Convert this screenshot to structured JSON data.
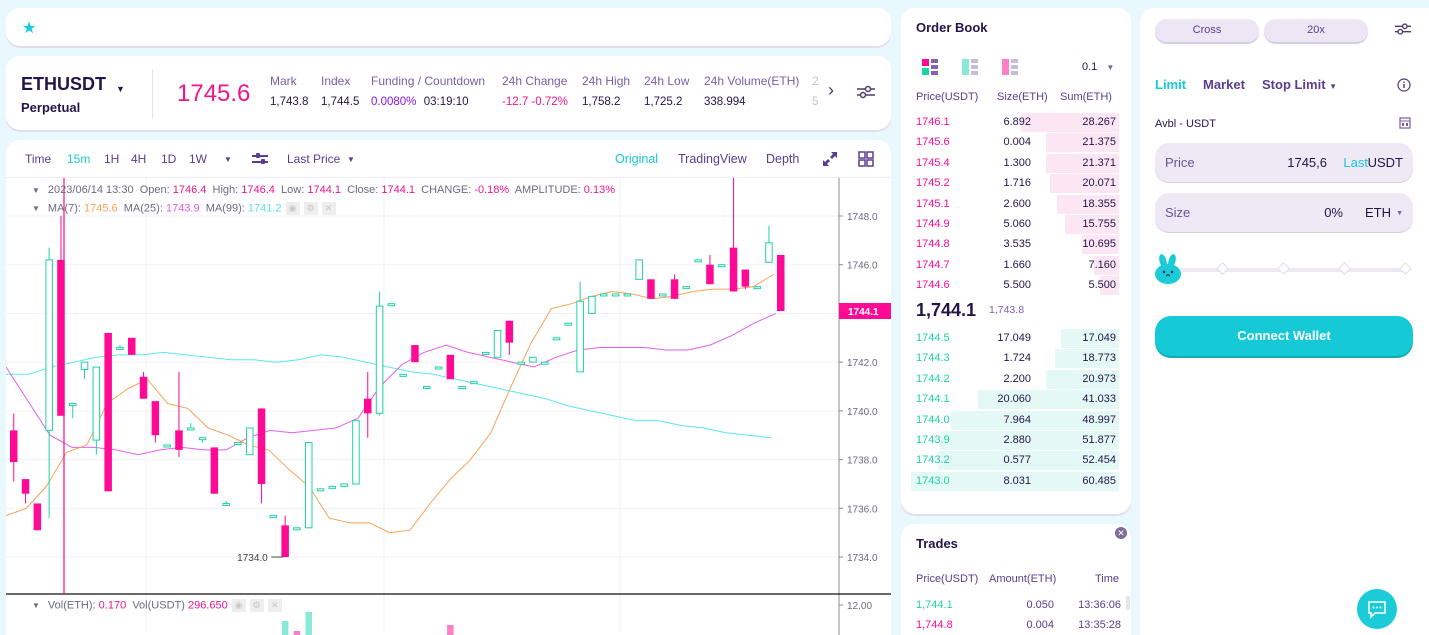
{
  "favorites": {
    "star_icon": "star-icon"
  },
  "ticker": {
    "symbol": "ETHUSDT",
    "type": "Perpetual",
    "last_price": "1745.6",
    "stats": [
      {
        "label": "Mark",
        "value": "1,743.8",
        "style": ""
      },
      {
        "label": "Index",
        "value": "1,744.5",
        "style": ""
      },
      {
        "label": "Funding / Countdown",
        "value": "0.0080%",
        "value2": "03:19:10",
        "style": "p"
      },
      {
        "label": "24h Change",
        "value": "-12.7 -0.72%",
        "style": "r"
      },
      {
        "label": "24h High",
        "value": "1,758.2",
        "style": ""
      },
      {
        "label": "24h Low",
        "value": "1,725.2",
        "style": ""
      },
      {
        "label": "24h Volume(ETH)",
        "value": "338.994",
        "style": ""
      },
      {
        "label": "2",
        "value": "5",
        "style": "faded"
      }
    ]
  },
  "chart_toolbar": {
    "intervals": [
      "Time",
      "15m",
      "1H",
      "4H",
      "1D",
      "1W"
    ],
    "active_interval": "15m",
    "price_type": "Last Price",
    "views": [
      "Original",
      "TradingView",
      "Depth"
    ],
    "active_view": "Original"
  },
  "chart_legend": {
    "date": "2023/06/14 13:30",
    "open_label": "Open:",
    "open": "1746.4",
    "high_label": "High:",
    "high": "1746.4",
    "low_label": "Low:",
    "low": "1744.1",
    "close_label": "Close:",
    "close": "1744.1",
    "change_label": "CHANGE:",
    "change": "-0.18%",
    "amp_label": "AMPLITUDE:",
    "amplitude": "0.13%",
    "ma7_label": "MA(7):",
    "ma7": "1745.6",
    "ma25_label": "MA(25):",
    "ma25": "1743.9",
    "ma99_label": "MA(99):",
    "ma99": "1741.2",
    "vol_eth_label": "Vol(ETH):",
    "vol_eth": "0.170",
    "vol_usdt_label": "Vol(USDT)",
    "vol_usdt": "296.650"
  },
  "chart_data": {
    "type": "candlestick",
    "title": "ETHUSDT 15m",
    "ylim": [
      1732.4,
      1749.4
    ],
    "yticks": [
      1748.0,
      1746.0,
      1744.0,
      1742.0,
      1740.0,
      1738.0,
      1736.0,
      1734.0
    ],
    "ytick_labels": [
      "1748.0",
      "1746.0",
      "",
      "1742.0",
      "1740.0",
      "1738.0",
      "1736.0",
      "1734.0"
    ],
    "current_price_label": "1744.1",
    "min_marker_label": "1734.0",
    "vol_ytick_label": "12.00",
    "candles": [
      {
        "o": 1739.2,
        "h": 1739.9,
        "l": 1737.1,
        "c": 1737.9
      },
      {
        "o": 1737.2,
        "h": 1737.2,
        "l": 1736.2,
        "c": 1736.6
      },
      {
        "o": 1736.2,
        "h": 1736.2,
        "l": 1735.1,
        "c": 1735.1
      },
      {
        "o": 1739.2,
        "h": 1746.7,
        "l": 1735.6,
        "c": 1746.2
      },
      {
        "o": 1746.2,
        "h": 1748.0,
        "l": 1739.8,
        "c": 1739.8
      },
      {
        "o": 1740.3,
        "h": 1740.3,
        "l": 1739.7,
        "c": 1740.3
      },
      {
        "o": 1741.7,
        "h": 1742.0,
        "l": 1741.3,
        "c": 1742.0
      },
      {
        "o": 1738.8,
        "h": 1741.8,
        "l": 1738.2,
        "c": 1741.8
      },
      {
        "o": 1743.2,
        "h": 1743.2,
        "l": 1736.7,
        "c": 1736.7
      },
      {
        "o": 1742.6,
        "h": 1742.7,
        "l": 1742.6,
        "c": 1742.6
      },
      {
        "o": 1743.0,
        "h": 1743.0,
        "l": 1742.3,
        "c": 1742.3
      },
      {
        "o": 1741.4,
        "h": 1741.6,
        "l": 1740.5,
        "c": 1740.5
      },
      {
        "o": 1740.4,
        "h": 1740.4,
        "l": 1738.7,
        "c": 1739.0
      },
      {
        "o": 1738.6,
        "h": 1738.6,
        "l": 1738.6,
        "c": 1738.6
      },
      {
        "o": 1739.2,
        "h": 1741.6,
        "l": 1738.1,
        "c": 1738.4
      },
      {
        "o": 1739.3,
        "h": 1739.5,
        "l": 1739.3,
        "c": 1739.3
      },
      {
        "o": 1738.9,
        "h": 1738.9,
        "l": 1738.7,
        "c": 1738.9
      },
      {
        "o": 1738.5,
        "h": 1738.5,
        "l": 1736.6,
        "c": 1736.6
      },
      {
        "o": 1736.2,
        "h": 1736.3,
        "l": 1736.2,
        "c": 1736.2
      },
      {
        "o": 1738.7,
        "h": 1738.7,
        "l": 1738.7,
        "c": 1738.7
      },
      {
        "o": 1738.2,
        "h": 1739.3,
        "l": 1738.2,
        "c": 1739.3
      },
      {
        "o": 1740.1,
        "h": 1740.1,
        "l": 1736.2,
        "c": 1737.0
      },
      {
        "o": 1735.7,
        "h": 1735.7,
        "l": 1735.7,
        "c": 1735.7
      },
      {
        "o": 1735.3,
        "h": 1735.7,
        "l": 1734.0,
        "c": 1734.0
      },
      {
        "o": 1735.2,
        "h": 1735.2,
        "l": 1735.2,
        "c": 1735.2
      },
      {
        "o": 1735.2,
        "h": 1738.7,
        "l": 1735.2,
        "c": 1738.7
      },
      {
        "o": 1736.8,
        "h": 1736.8,
        "l": 1736.8,
        "c": 1736.8
      },
      {
        "o": 1736.9,
        "h": 1736.9,
        "l": 1736.9,
        "c": 1736.9
      },
      {
        "o": 1736.9,
        "h": 1737.0,
        "l": 1736.9,
        "c": 1737.0
      },
      {
        "o": 1737.0,
        "h": 1739.6,
        "l": 1737.0,
        "c": 1739.6
      },
      {
        "o": 1740.5,
        "h": 1741.6,
        "l": 1738.9,
        "c": 1739.9
      },
      {
        "o": 1739.9,
        "h": 1744.9,
        "l": 1739.8,
        "c": 1744.3
      },
      {
        "o": 1744.4,
        "h": 1744.4,
        "l": 1744.4,
        "c": 1744.4
      },
      {
        "o": 1741.5,
        "h": 1741.5,
        "l": 1741.5,
        "c": 1741.5
      },
      {
        "o": 1742.7,
        "h": 1742.7,
        "l": 1742.0,
        "c": 1742.0
      },
      {
        "o": 1741.0,
        "h": 1741.0,
        "l": 1741.0,
        "c": 1741.0
      },
      {
        "o": 1741.8,
        "h": 1741.8,
        "l": 1741.8,
        "c": 1741.8
      },
      {
        "o": 1742.3,
        "h": 1742.3,
        "l": 1741.3,
        "c": 1741.3
      },
      {
        "o": 1741.0,
        "h": 1741.0,
        "l": 1741.0,
        "c": 1741.0
      },
      {
        "o": 1741.2,
        "h": 1741.2,
        "l": 1741.2,
        "c": 1741.2
      },
      {
        "o": 1742.4,
        "h": 1742.4,
        "l": 1742.4,
        "c": 1742.4
      },
      {
        "o": 1742.2,
        "h": 1743.3,
        "l": 1742.2,
        "c": 1743.3
      },
      {
        "o": 1743.7,
        "h": 1743.7,
        "l": 1742.3,
        "c": 1742.8
      },
      {
        "o": 1742.0,
        "h": 1742.0,
        "l": 1742.0,
        "c": 1742.0
      },
      {
        "o": 1742.0,
        "h": 1742.2,
        "l": 1742.0,
        "c": 1742.2
      },
      {
        "o": 1742.0,
        "h": 1742.0,
        "l": 1742.0,
        "c": 1742.0
      },
      {
        "o": 1743.0,
        "h": 1743.0,
        "l": 1743.0,
        "c": 1743.0
      },
      {
        "o": 1743.6,
        "h": 1743.6,
        "l": 1743.5,
        "c": 1743.6
      },
      {
        "o": 1741.6,
        "h": 1745.3,
        "l": 1741.6,
        "c": 1744.5
      },
      {
        "o": 1744.0,
        "h": 1744.7,
        "l": 1744.0,
        "c": 1744.7
      },
      {
        "o": 1744.8,
        "h": 1744.8,
        "l": 1744.8,
        "c": 1744.8
      },
      {
        "o": 1744.8,
        "h": 1744.8,
        "l": 1744.8,
        "c": 1744.8
      },
      {
        "o": 1744.8,
        "h": 1744.8,
        "l": 1744.8,
        "c": 1744.8
      },
      {
        "o": 1745.4,
        "h": 1746.2,
        "l": 1745.4,
        "c": 1746.2
      },
      {
        "o": 1745.4,
        "h": 1745.4,
        "l": 1744.6,
        "c": 1744.6
      },
      {
        "o": 1744.8,
        "h": 1744.8,
        "l": 1744.8,
        "c": 1744.8
      },
      {
        "o": 1745.4,
        "h": 1745.6,
        "l": 1744.6,
        "c": 1744.6
      },
      {
        "o": 1745.1,
        "h": 1745.1,
        "l": 1745.1,
        "c": 1745.1
      },
      {
        "o": 1746.2,
        "h": 1746.2,
        "l": 1746.2,
        "c": 1746.2
      },
      {
        "o": 1746.0,
        "h": 1746.4,
        "l": 1745.2,
        "c": 1745.2
      },
      {
        "o": 1746.0,
        "h": 1746.0,
        "l": 1746.0,
        "c": 1746.0
      },
      {
        "o": 1746.7,
        "h": 1750.0,
        "l": 1744.9,
        "c": 1744.9
      },
      {
        "o": 1745.8,
        "h": 1745.8,
        "l": 1745.0,
        "c": 1745.1
      },
      {
        "o": 1745.1,
        "h": 1745.1,
        "l": 1745.1,
        "c": 1745.1
      },
      {
        "o": 1746.1,
        "h": 1747.6,
        "l": 1746.1,
        "c": 1746.9
      },
      {
        "o": 1746.4,
        "h": 1746.4,
        "l": 1744.1,
        "c": 1744.1
      }
    ],
    "ma7": [
      1735.7,
      1736.0,
      1736.9,
      1738.3,
      1738.6,
      1740.3,
      1740.9,
      1741.3,
      1740.3,
      1740.1,
      1739.3,
      1739.0,
      1738.6,
      1738.4,
      1737.6,
      1736.9,
      1735.6,
      1735.4,
      1735.4,
      1735.0,
      1735.1,
      1736.2,
      1737.2,
      1738.0,
      1739.1,
      1741.0,
      1742.8,
      1744.2,
      1744.4,
      1744.7,
      1744.9,
      1744.8,
      1744.6,
      1744.7,
      1744.9,
      1745.0,
      1745.0,
      1745.1,
      1745.6
    ],
    "ma7_x_start": 0,
    "ma25": [
      1741.8,
      1740.4,
      1739.0,
      1738.5,
      1738.5,
      1738.4,
      1738.2,
      1738.4,
      1738.5,
      1738.4,
      1738.4,
      1738.9,
      1739.2,
      1739.1,
      1739.2,
      1739.3,
      1739.7,
      1741.0,
      1741.9,
      1742.4,
      1742.7,
      1742.4,
      1742.2,
      1742.0,
      1741.8,
      1742.2,
      1742.5,
      1742.6,
      1742.6,
      1742.6,
      1742.5,
      1742.5,
      1742.7,
      1743.1,
      1743.6,
      1744.0
    ],
    "ma99": [
      1741.5,
      1741.5,
      1741.8,
      1742.0,
      1742.2,
      1742.3,
      1742.3,
      1742.4,
      1742.3,
      1742.2,
      1742.1,
      1742.1,
      1742.0,
      1742.1,
      1742.3,
      1742.2,
      1742.0,
      1741.8,
      1741.6,
      1741.5,
      1741.3,
      1741.1,
      1740.9,
      1740.7,
      1740.5,
      1740.2,
      1740.0,
      1739.8,
      1739.6,
      1739.6,
      1739.4,
      1739.3,
      1739.1,
      1739.0,
      1738.9
    ],
    "volumes_visible": [
      {
        "index": 23,
        "v": 7.0,
        "dir": "up"
      },
      {
        "index": 24,
        "v": 2.0,
        "dir": "down"
      },
      {
        "index": 25,
        "v": 11.5,
        "dir": "up"
      },
      {
        "index": 37,
        "v": 5.0,
        "dir": "down"
      }
    ]
  },
  "orderbook": {
    "title": "Order Book",
    "precision": "0.1",
    "headers": [
      "Price(USDT)",
      "Size(ETH)",
      "Sum(ETH)"
    ],
    "asks": [
      {
        "price": "1746.1",
        "size": "6.892",
        "sum": "28.267",
        "depth": 0.47
      },
      {
        "price": "1745.6",
        "size": "0.004",
        "sum": "21.375",
        "depth": 0.35
      },
      {
        "price": "1745.4",
        "size": "1.300",
        "sum": "21.371",
        "depth": 0.35
      },
      {
        "price": "1745.2",
        "size": "1.716",
        "sum": "20.071",
        "depth": 0.33
      },
      {
        "price": "1745.1",
        "size": "2.600",
        "sum": "18.355",
        "depth": 0.3
      },
      {
        "price": "1744.9",
        "size": "5.060",
        "sum": "15.755",
        "depth": 0.26
      },
      {
        "price": "1744.8",
        "size": "3.535",
        "sum": "10.695",
        "depth": 0.18
      },
      {
        "price": "1744.7",
        "size": "1.660",
        "sum": "7.160",
        "depth": 0.12
      },
      {
        "price": "1744.6",
        "size": "5.500",
        "sum": "5.500",
        "depth": 0.09
      }
    ],
    "mid_price": "1,744.1",
    "mark_price": "1,743.8",
    "bids": [
      {
        "price": "1744.5",
        "size": "17.049",
        "sum": "17.049",
        "depth": 0.28
      },
      {
        "price": "1744.3",
        "size": "1.724",
        "sum": "18.773",
        "depth": 0.31
      },
      {
        "price": "1744.2",
        "size": "2.200",
        "sum": "20.973",
        "depth": 0.35
      },
      {
        "price": "1744.1",
        "size": "20.060",
        "sum": "41.033",
        "depth": 0.68
      },
      {
        "price": "1744.0",
        "size": "7.964",
        "sum": "48.997",
        "depth": 0.81
      },
      {
        "price": "1743.9",
        "size": "2.880",
        "sum": "51.877",
        "depth": 0.86
      },
      {
        "price": "1743.2",
        "size": "0.577",
        "sum": "52.454",
        "depth": 0.87
      },
      {
        "price": "1743.0",
        "size": "8.031",
        "sum": "60.485",
        "depth": 1.0
      }
    ]
  },
  "trades": {
    "title": "Trades",
    "headers": [
      "Price(USDT)",
      "Amount(ETH)",
      "Time"
    ],
    "rows": [
      {
        "price": "1,744.1",
        "amount": "0.050",
        "time": "13:36:06",
        "side": "buy"
      },
      {
        "price": "1,744.8",
        "amount": "0.004",
        "time": "13:35:28",
        "side": "sell"
      }
    ]
  },
  "order_form": {
    "margin_mode": "Cross",
    "leverage": "20x",
    "order_types": [
      "Limit",
      "Market",
      "Stop Limit"
    ],
    "active_type": "Limit",
    "available": "Avbl - USDT",
    "price_label": "Price",
    "price_value": "1745,6",
    "price_last": "Last",
    "price_unit": "USDT",
    "size_label": "Size",
    "size_value": "0%",
    "size_unit": "ETH",
    "slider_percent": 0,
    "connect_label": "Connect Wallet"
  },
  "colors": {
    "up": "#1ed2a8",
    "down": "#ff0a94",
    "accent": "#16c9d6",
    "ma7": "#f7a258",
    "ma25": "#e35ef0",
    "ma99": "#59e6f2"
  }
}
